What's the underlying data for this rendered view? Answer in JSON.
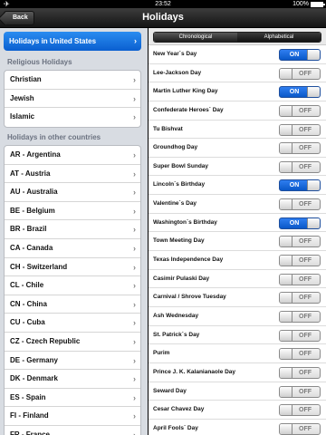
{
  "status": {
    "time": "23:52",
    "battery": "100%",
    "airplane_icon": "airplane-icon"
  },
  "navbar": {
    "title": "Holidays",
    "back_label": "Back"
  },
  "sidebar": {
    "selected": "Holidays in United States",
    "religious_header": "Religious Holidays",
    "religious": [
      "Christian",
      "Jewish",
      "Islamic"
    ],
    "other_header": "Holidays in other countries",
    "countries": [
      "AR - Argentina",
      "AT - Austria",
      "AU - Australia",
      "BE - Belgium",
      "BR - Brazil",
      "CA - Canada",
      "CH - Switzerland",
      "CL - Chile",
      "CN - China",
      "CU - Cuba",
      "CZ - Czech Republic",
      "DE - Germany",
      "DK - Denmark",
      "ES - Spain",
      "FI - Finland",
      "FR - France"
    ]
  },
  "segment": {
    "chronological": "Chronological",
    "alphabetical": "Alphabetical",
    "selected": "Chronological"
  },
  "toggle_labels": {
    "on": "ON",
    "off": "OFF"
  },
  "holidays": [
    {
      "name": "New Year`s Day",
      "on": true
    },
    {
      "name": "Lee-Jackson Day",
      "on": false
    },
    {
      "name": "Martin Luther King Day",
      "on": true
    },
    {
      "name": "Confederate Heroes` Day",
      "on": false
    },
    {
      "name": "Tu Bishvat",
      "on": false
    },
    {
      "name": "Groundhog Day",
      "on": false
    },
    {
      "name": "Super Bowl Sunday",
      "on": false
    },
    {
      "name": "Lincoln`s Birthday",
      "on": true
    },
    {
      "name": "Valentine`s Day",
      "on": false
    },
    {
      "name": "Washington`s Birthday",
      "on": true
    },
    {
      "name": "Town Meeting Day",
      "on": false
    },
    {
      "name": "Texas Independence Day",
      "on": false
    },
    {
      "name": "Casimir Pulaski Day",
      "on": false
    },
    {
      "name": "Carnival / Shrove Tuesday",
      "on": false
    },
    {
      "name": "Ash Wednesday",
      "on": false
    },
    {
      "name": "St. Patrick`s Day",
      "on": false
    },
    {
      "name": "Purim",
      "on": false
    },
    {
      "name": "Prince J. K. Kalanianaole Day",
      "on": false
    },
    {
      "name": "Seward Day",
      "on": false
    },
    {
      "name": "Cesar Chavez Day",
      "on": false
    },
    {
      "name": "April Fools` Day",
      "on": false
    }
  ]
}
